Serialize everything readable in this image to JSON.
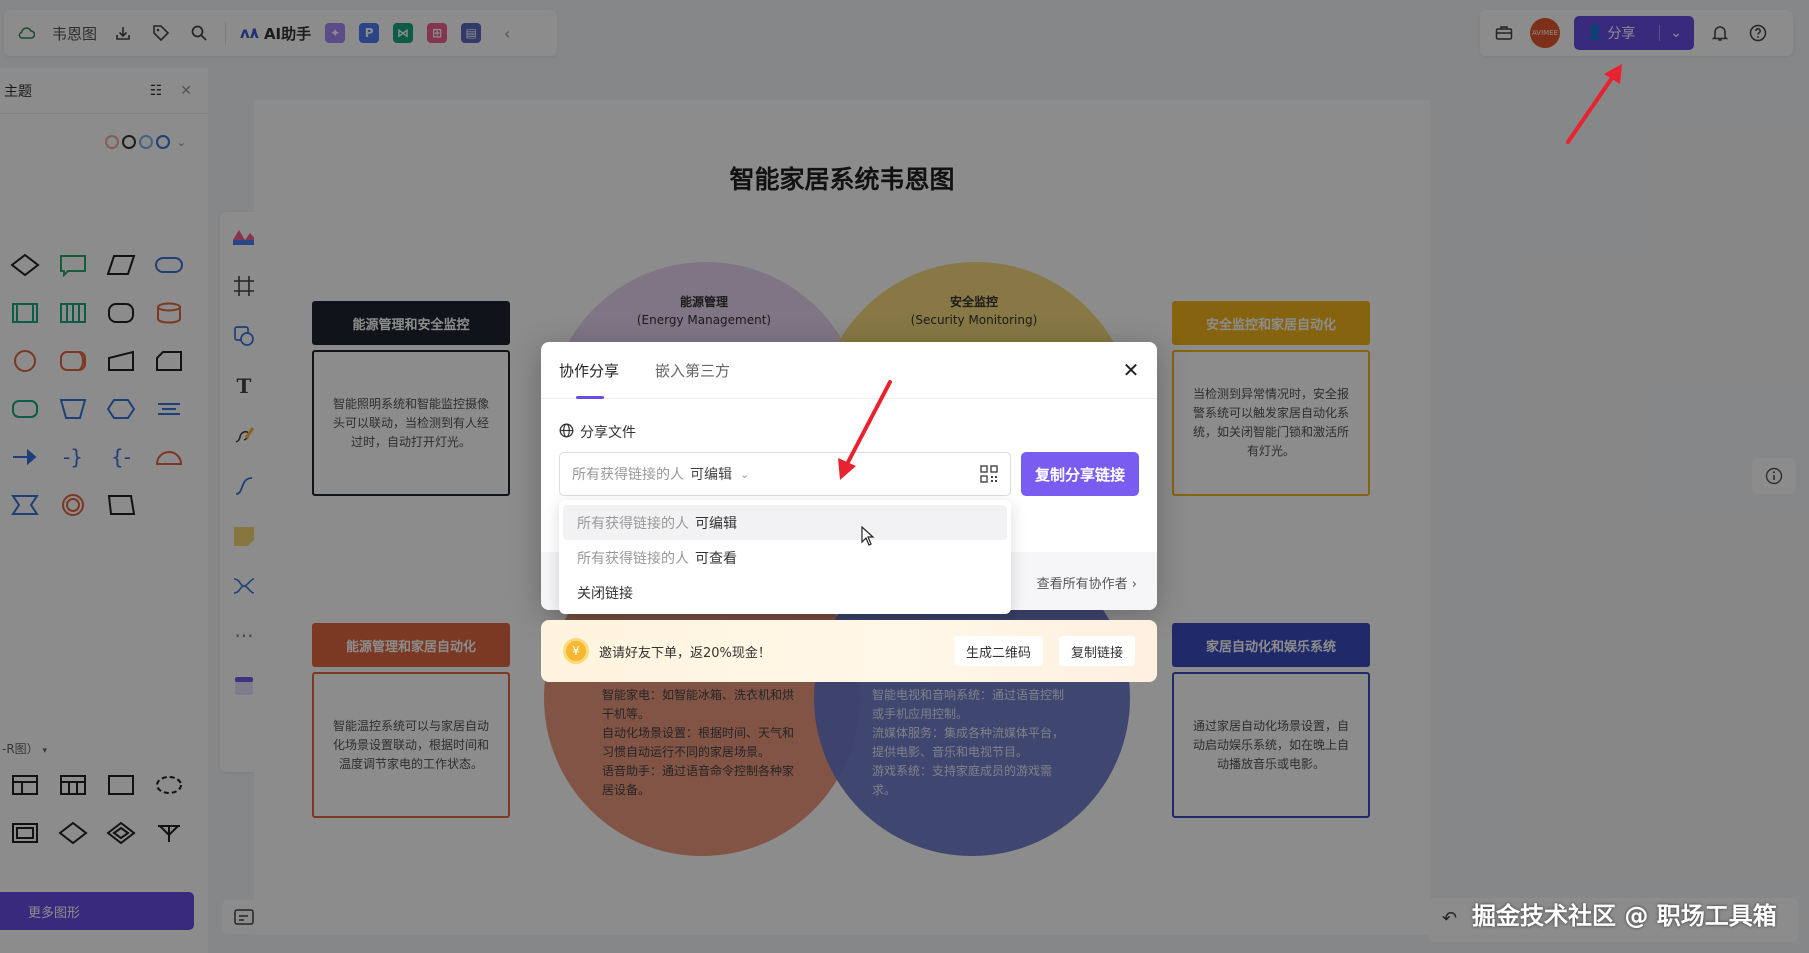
{
  "topbar": {
    "doc_title": "韦恩图",
    "ai_label": "AI助手",
    "share_label": "分享",
    "avatar_text": "AVIMEE"
  },
  "left_panel": {
    "title": "主题",
    "er_label": "-R图）",
    "more_shapes": "更多图形"
  },
  "diagram": {
    "title": "智能家居系统韦恩图",
    "circles": [
      {
        "label_line1": "能源管理",
        "label_line2": "(Energy Management)",
        "color": "#d9b8e8"
      },
      {
        "label_line1": "安全监控",
        "label_line2": "(Security Monitoring)",
        "color": "#f2c94c"
      },
      {
        "color": "#e8886c"
      },
      {
        "color": "#5c6bc0"
      }
    ],
    "boxes": [
      {
        "title": "能源管理和安全监控",
        "title_color": "#1f2430",
        "body": "智能照明系统和智能监控摄像头可以联动，当检测到有人经过时，自动打开灯光。",
        "border": "#1f2430"
      },
      {
        "title": "安全监控和家居自动化",
        "title_color": "#f2b51d",
        "body": "当检测到异常情况时，安全报警系统可以触发家居自动化系统，如关闭智能门锁和激活所有灯光。",
        "border": "#f2b51d"
      },
      {
        "title": "能源管理和家居自动化",
        "title_color": "#e0663f",
        "body": "智能温控系统可以与家居自动化场景设置联动，根据时间和温度调节家电的工作状态。",
        "border": "#e0663f"
      },
      {
        "title": "家居自动化和娱乐系统",
        "title_color": "#3b4cc0",
        "body": "通过家居自动化场景设置，自动启动娱乐系统，如在晚上自动播放音乐或电影。",
        "border": "#3b4cc0"
      }
    ],
    "circle_texts": {
      "home_auto": "智能家电：如智能冰箱、洗衣机和烘干机等。\n自动化场景设置：根据时间、天气和习惯自动运行不同的家居场景。\n语音助手：通过语音命令控制各种家居设备。",
      "entertainment": "智能电视和音响系统：通过语音控制或手机应用控制。\n流媒体服务：集成各种流媒体平台，提供电影、音乐和电视节目。\n游戏系统：支持家庭成员的游戏需求。"
    }
  },
  "modal": {
    "tabs": [
      {
        "label": "协作分享",
        "active": true
      },
      {
        "label": "嵌入第三方",
        "active": false
      }
    ],
    "share_file_label": "分享文件",
    "select_prefix": "所有获得链接的人",
    "select_value": "可编辑",
    "copy_button": "复制分享链接",
    "view_collaborators": "查看所有协作者",
    "dropdown": [
      {
        "prefix": "所有获得链接的人",
        "perm": "可编辑"
      },
      {
        "prefix": "所有获得链接的人",
        "perm": "可查看"
      },
      {
        "label": "关闭链接"
      }
    ]
  },
  "banner": {
    "text": "邀请好友下单，返20%现金！",
    "qr_button": "生成二维码",
    "copy_button": "复制链接"
  },
  "watermark": "掘金技术社区 @ 职场工具箱",
  "colors": {
    "accent": "#6b4de6",
    "arrow": "#e8222e"
  }
}
